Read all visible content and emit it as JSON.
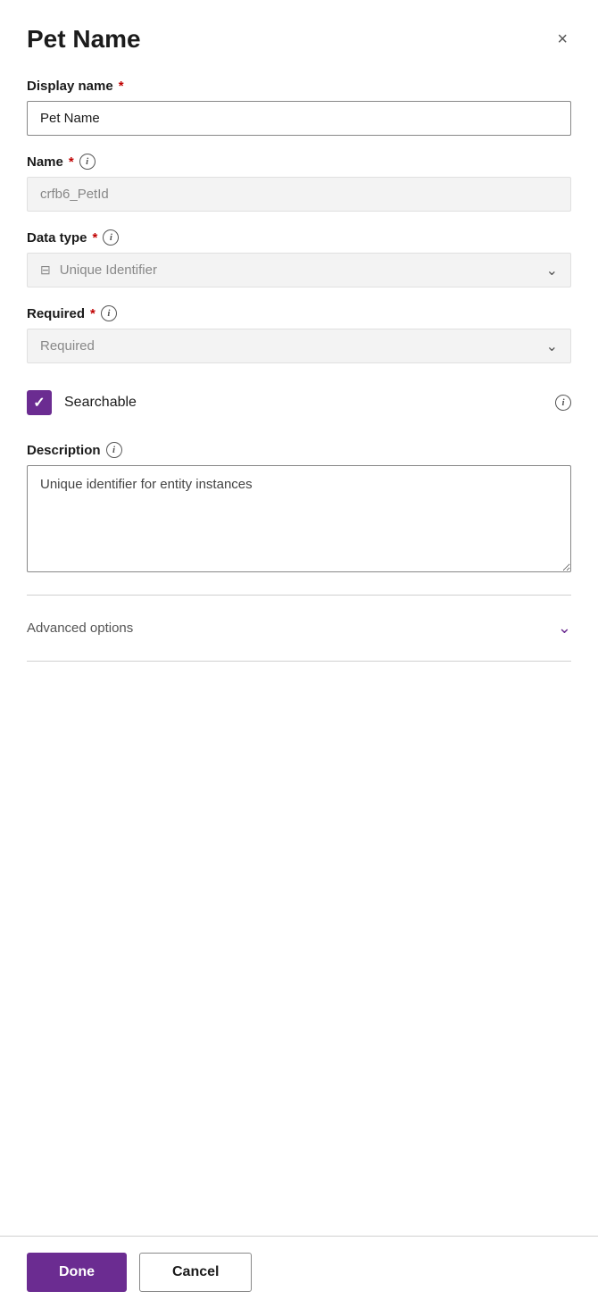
{
  "header": {
    "title": "Pet Name",
    "close_label": "×"
  },
  "fields": {
    "display_name": {
      "label": "Display name",
      "required": true,
      "value": "Pet Name",
      "placeholder": "Pet Name"
    },
    "name": {
      "label": "Name",
      "required": true,
      "has_info": true,
      "value": "crfb6_PetId",
      "placeholder": "crfb6_PetId",
      "readonly": true
    },
    "data_type": {
      "label": "Data type",
      "required": true,
      "has_info": true,
      "value": "Unique Identifier",
      "icon": "⊟"
    },
    "required_field": {
      "label": "Required",
      "required": true,
      "has_info": true,
      "value": "Required"
    },
    "searchable": {
      "label": "Searchable",
      "checked": true,
      "has_info": true
    },
    "description": {
      "label": "Description",
      "has_info": true,
      "value": "Unique identifier for entity instances"
    }
  },
  "advanced_options": {
    "label": "Advanced options"
  },
  "footer": {
    "done_label": "Done",
    "cancel_label": "Cancel"
  }
}
